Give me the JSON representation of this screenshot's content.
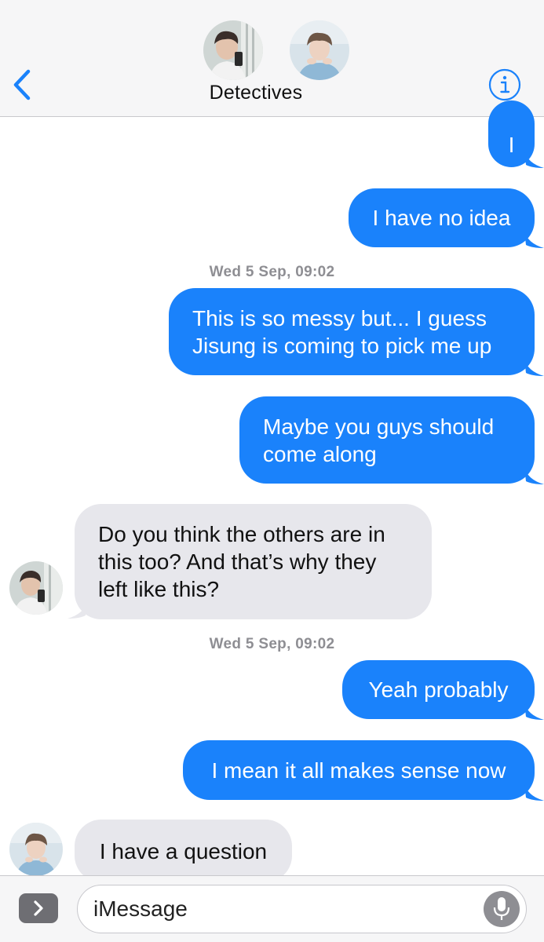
{
  "header": {
    "back_icon": "chevron-left-icon",
    "title": "Detectives",
    "info_icon": "info-icon",
    "accent": "#1a82fb"
  },
  "messages": [
    {
      "type": "sent",
      "text": "I"
    },
    {
      "type": "sent",
      "text": "I have no idea"
    },
    {
      "type": "timestamp",
      "text": "Wed 5 Sep, 09:02"
    },
    {
      "type": "sent",
      "text": "This is so messy but... I guess\nJisung is coming to pick me up"
    },
    {
      "type": "sent",
      "text": "Maybe you guys should\ncome along"
    },
    {
      "type": "received",
      "text": "Do you think the others are in\nthis too? And that’s why they\nleft like this?"
    },
    {
      "type": "timestamp",
      "text": "Wed 5 Sep, 09:02"
    },
    {
      "type": "sent",
      "text": "Yeah probably"
    },
    {
      "type": "sent",
      "text": "I mean it all makes sense now"
    },
    {
      "type": "received",
      "text": "I have a question"
    }
  ],
  "composer": {
    "apps_icon": "chevron-right-icon",
    "placeholder": "iMessage",
    "mic_icon": "microphone-icon"
  },
  "colors": {
    "sent_bubble": "#1a82fb",
    "received_bubble": "#e7e7ec",
    "timestamp": "#8e8e93"
  }
}
